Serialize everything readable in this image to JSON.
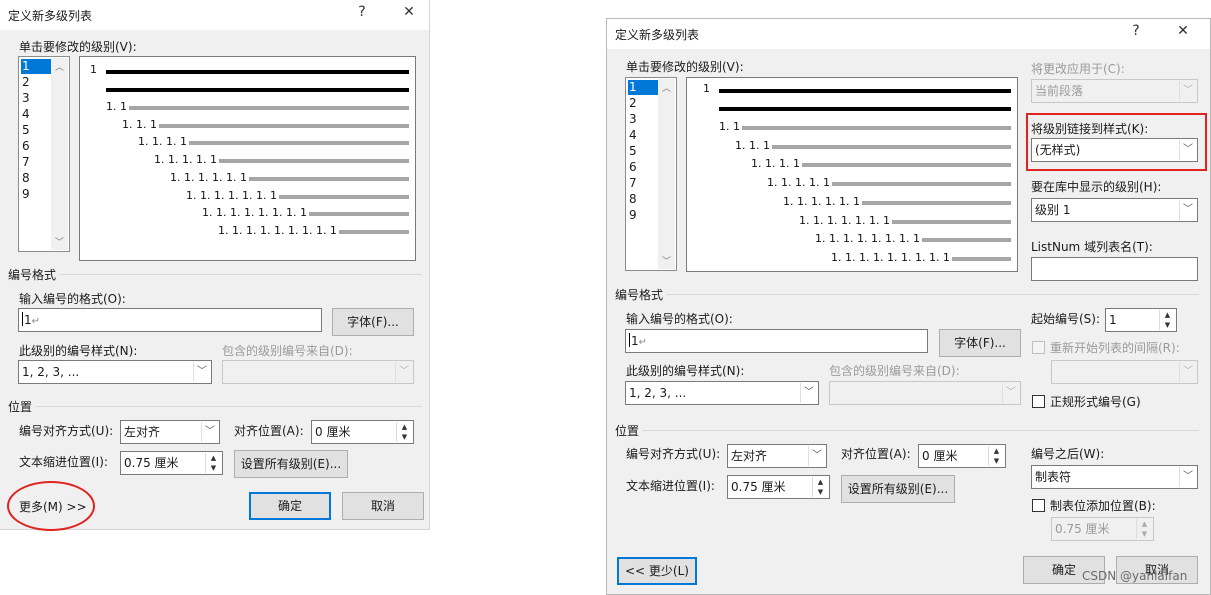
{
  "left": {
    "title": "定义新多级列表",
    "help": "?",
    "close": "✕",
    "level_label": "单击要修改的级别(V):",
    "levels": [
      "1",
      "2",
      "3",
      "4",
      "5",
      "6",
      "7",
      "8",
      "9"
    ],
    "selected_level": "1",
    "preview": [
      "1",
      "1. 1",
      "1. 1. 1",
      "1. 1. 1. 1",
      "1. 1. 1. 1. 1",
      "1. 1. 1. 1. 1. 1",
      "1. 1. 1. 1. 1. 1. 1",
      "1. 1. 1. 1. 1. 1. 1. 1",
      "1. 1. 1. 1. 1. 1. 1. 1. 1"
    ],
    "numbering_section": "编号格式",
    "format_label": "输入编号的格式(O):",
    "format_value": "1",
    "font_button": "字体(F)...",
    "style_label": "此级别的编号样式(N):",
    "style_value": "1, 2, 3, ...",
    "include_label": "包含的级别编号来自(D):",
    "include_value": "",
    "position_section": "位置",
    "align_label": "编号对齐方式(U):",
    "align_value": "左对齐",
    "alignpos_label": "对齐位置(A):",
    "alignpos_value": "0 厘米",
    "indent_label": "文本缩进位置(I):",
    "indent_value": "0.75 厘米",
    "setall_button": "设置所有级别(E)...",
    "more_button": "更多(M) >>",
    "ok_button": "确定",
    "cancel_button": "取消"
  },
  "right": {
    "title": "定义新多级列表",
    "help": "?",
    "close": "✕",
    "level_label": "单击要修改的级别(V):",
    "levels": [
      "1",
      "2",
      "3",
      "4",
      "5",
      "6",
      "7",
      "8",
      "9"
    ],
    "selected_level": "1",
    "preview": [
      "1",
      "1. 1",
      "1. 1. 1",
      "1. 1. 1. 1",
      "1. 1. 1. 1. 1",
      "1. 1. 1. 1. 1. 1",
      "1. 1. 1. 1. 1. 1. 1",
      "1. 1. 1. 1. 1. 1. 1. 1",
      "1. 1. 1. 1. 1. 1. 1. 1. 1"
    ],
    "apply_label": "将更改应用于(C):",
    "apply_value": "当前段落",
    "link_label": "将级别链接到样式(K):",
    "link_value": "(无样式)",
    "gallery_label": "要在库中显示的级别(H):",
    "gallery_value": "级别 1",
    "listnum_label": "ListNum 域列表名(T):",
    "listnum_value": "",
    "numbering_section": "编号格式",
    "format_label": "输入编号的格式(O):",
    "format_value": "1",
    "font_button": "字体(F)...",
    "start_label": "起始编号(S):",
    "start_value": "1",
    "restart_label": "重新开始列表的间隔(R):",
    "restart_value": "",
    "style_label": "此级别的编号样式(N):",
    "style_value": "1, 2, 3, ...",
    "include_label": "包含的级别编号来自(D):",
    "include_value": "",
    "legal_label": "正规形式编号(G)",
    "position_section": "位置",
    "align_label": "编号对齐方式(U):",
    "align_value": "左对齐",
    "alignpos_label": "对齐位置(A):",
    "alignpos_value": "0 厘米",
    "after_label": "编号之后(W):",
    "after_value": "制表符",
    "indent_label": "文本缩进位置(I):",
    "indent_value": "0.75 厘米",
    "setall_button": "设置所有级别(E)...",
    "tabstop_label": "制表位添加位置(B):",
    "tabstop_value": "0.75 厘米",
    "less_button": "<< 更少(L)",
    "ok_button": "确定",
    "cancel_button": "取消"
  },
  "watermark": "CSDN @yanlaifan",
  "colors": {
    "annotation": "#e0231f",
    "selection": "#0078d7",
    "default_button": "#0078d7"
  }
}
